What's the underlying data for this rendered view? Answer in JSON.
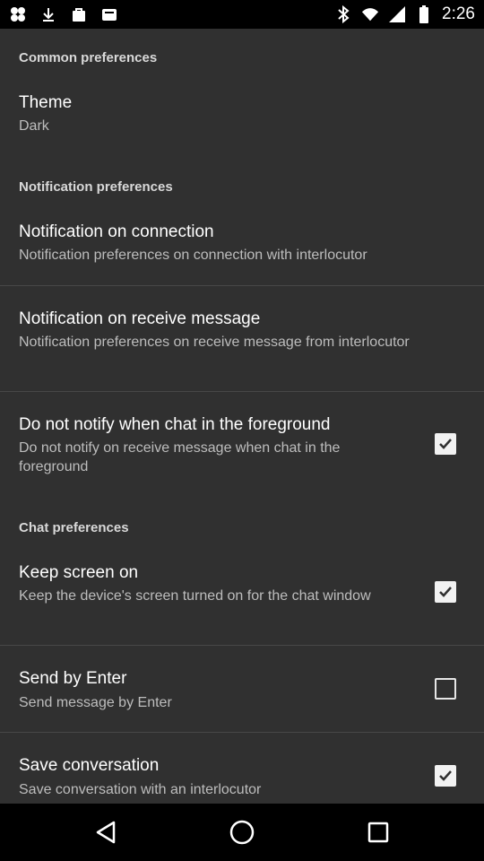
{
  "status_bar": {
    "time": "2:26",
    "left_icons": [
      "google-photos-icon",
      "download-icon",
      "store-bag-icon",
      "wallet-icon"
    ],
    "right_icons": [
      "bluetooth-icon",
      "wifi-icon",
      "signal-icon",
      "battery-icon"
    ]
  },
  "sections": {
    "common": {
      "header": "Common preferences"
    },
    "notification": {
      "header": "Notification preferences"
    },
    "chat": {
      "header": "Chat preferences"
    }
  },
  "prefs": {
    "theme": {
      "title": "Theme",
      "summary": "Dark"
    },
    "notif_connection": {
      "title": "Notification on connection",
      "summary": "Notification preferences on connection with interlocutor"
    },
    "notif_receive": {
      "title": "Notification on receive message",
      "summary": "Notification preferences on receive message from interlocutor"
    },
    "do_not_notify": {
      "title": "Do not notify when chat in the foreground",
      "summary": "Do not notify on receive message when chat in the foreground",
      "checked": true
    },
    "keep_screen": {
      "title": "Keep screen on",
      "summary": "Keep the device's screen turned on for the chat window",
      "checked": true
    },
    "send_enter": {
      "title": "Send by Enter",
      "summary": "Send message by Enter",
      "checked": false
    },
    "save_conversation": {
      "title": "Save conversation",
      "summary": "Save conversation with an interlocutor",
      "checked": true
    }
  },
  "nav_bar": [
    "back-icon",
    "home-icon",
    "recents-icon"
  ]
}
